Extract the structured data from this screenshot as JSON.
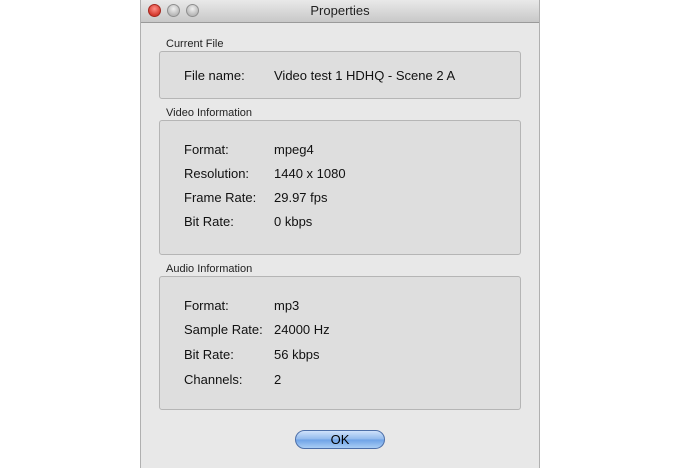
{
  "window": {
    "title": "Properties"
  },
  "current_file": {
    "label": "Current File",
    "rows": [
      {
        "key": "File name:",
        "value": "Video test 1 HDHQ - Scene 2 A"
      }
    ]
  },
  "video": {
    "label": "Video Information",
    "rows": [
      {
        "key": "Format:",
        "value": "mpeg4"
      },
      {
        "key": "Resolution:",
        "value": "1440 x 1080"
      },
      {
        "key": "Frame Rate:",
        "value": "29.97 fps"
      },
      {
        "key": "Bit Rate:",
        "value": "0 kbps"
      }
    ]
  },
  "audio": {
    "label": "Audio Information",
    "rows": [
      {
        "key": "Format:",
        "value": "mp3"
      },
      {
        "key": "Sample Rate:",
        "value": "24000 Hz"
      },
      {
        "key": "Bit Rate:",
        "value": "56 kbps"
      },
      {
        "key": "Channels:",
        "value": "2"
      }
    ]
  },
  "buttons": {
    "ok_label": "OK"
  }
}
